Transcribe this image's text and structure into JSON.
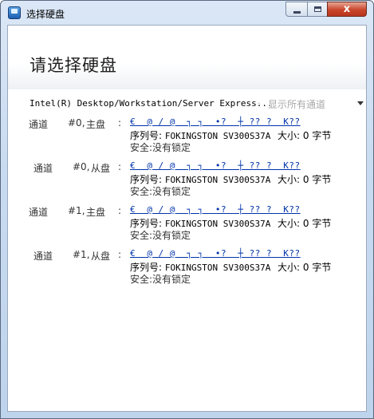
{
  "window": {
    "title": "选择硬盘",
    "controls": {
      "minimize": "",
      "maximize": "",
      "close": "x"
    }
  },
  "heading": "请选择硬盘",
  "controller": {
    "name": "Intel(R) Desktop/Workstation/Server Express...",
    "separator": "·",
    "show_all_label": "显示所有通道"
  },
  "drives": [
    {
      "channel_label": "通道",
      "channel_id": "#0,",
      "role": "主盘",
      "colon": ":",
      "model": "€  @ / @  ┐ ┐  •?  ┼ ?? ?  K??",
      "serial_label": "序列号:",
      "serial": "FOKINGSTON SV300S37A",
      "size_label": "大小:",
      "size_value": "0 字节",
      "security_label": "安全:",
      "security_value": "没有锁定"
    },
    {
      "channel_label": "通道",
      "channel_id": "#0,",
      "role": "从盘",
      "colon": ":",
      "model": "€  @ / @  ┐ ┐  •?  ┼ ?? ?  K??",
      "serial_label": "序列号:",
      "serial": "FOKINGSTON SV300S37A",
      "size_label": "大小:",
      "size_value": "0 字节",
      "security_label": "安全:",
      "security_value": "没有锁定"
    },
    {
      "channel_label": "通道",
      "channel_id": "#1,",
      "role": "主盘",
      "colon": ":",
      "model": "€  @ / @  ┐ ┐  •?  ┼ ?? ?  K??",
      "serial_label": "序列号:",
      "serial": "FOKINGSTON SV300S37A",
      "size_label": "大小:",
      "size_value": "0 字节",
      "security_label": "安全:",
      "security_value": "没有锁定"
    },
    {
      "channel_label": "通道",
      "channel_id": "#1,",
      "role": "从盘",
      "colon": ":",
      "model": "€  @ / @  ┐ ┐  •?  ┼ ?? ?  K??",
      "serial_label": "序列号:",
      "serial": "FOKINGSTON SV300S37A",
      "size_label": "大小:",
      "size_value": "0 字节",
      "security_label": "安全:",
      "security_value": "没有锁定"
    }
  ]
}
